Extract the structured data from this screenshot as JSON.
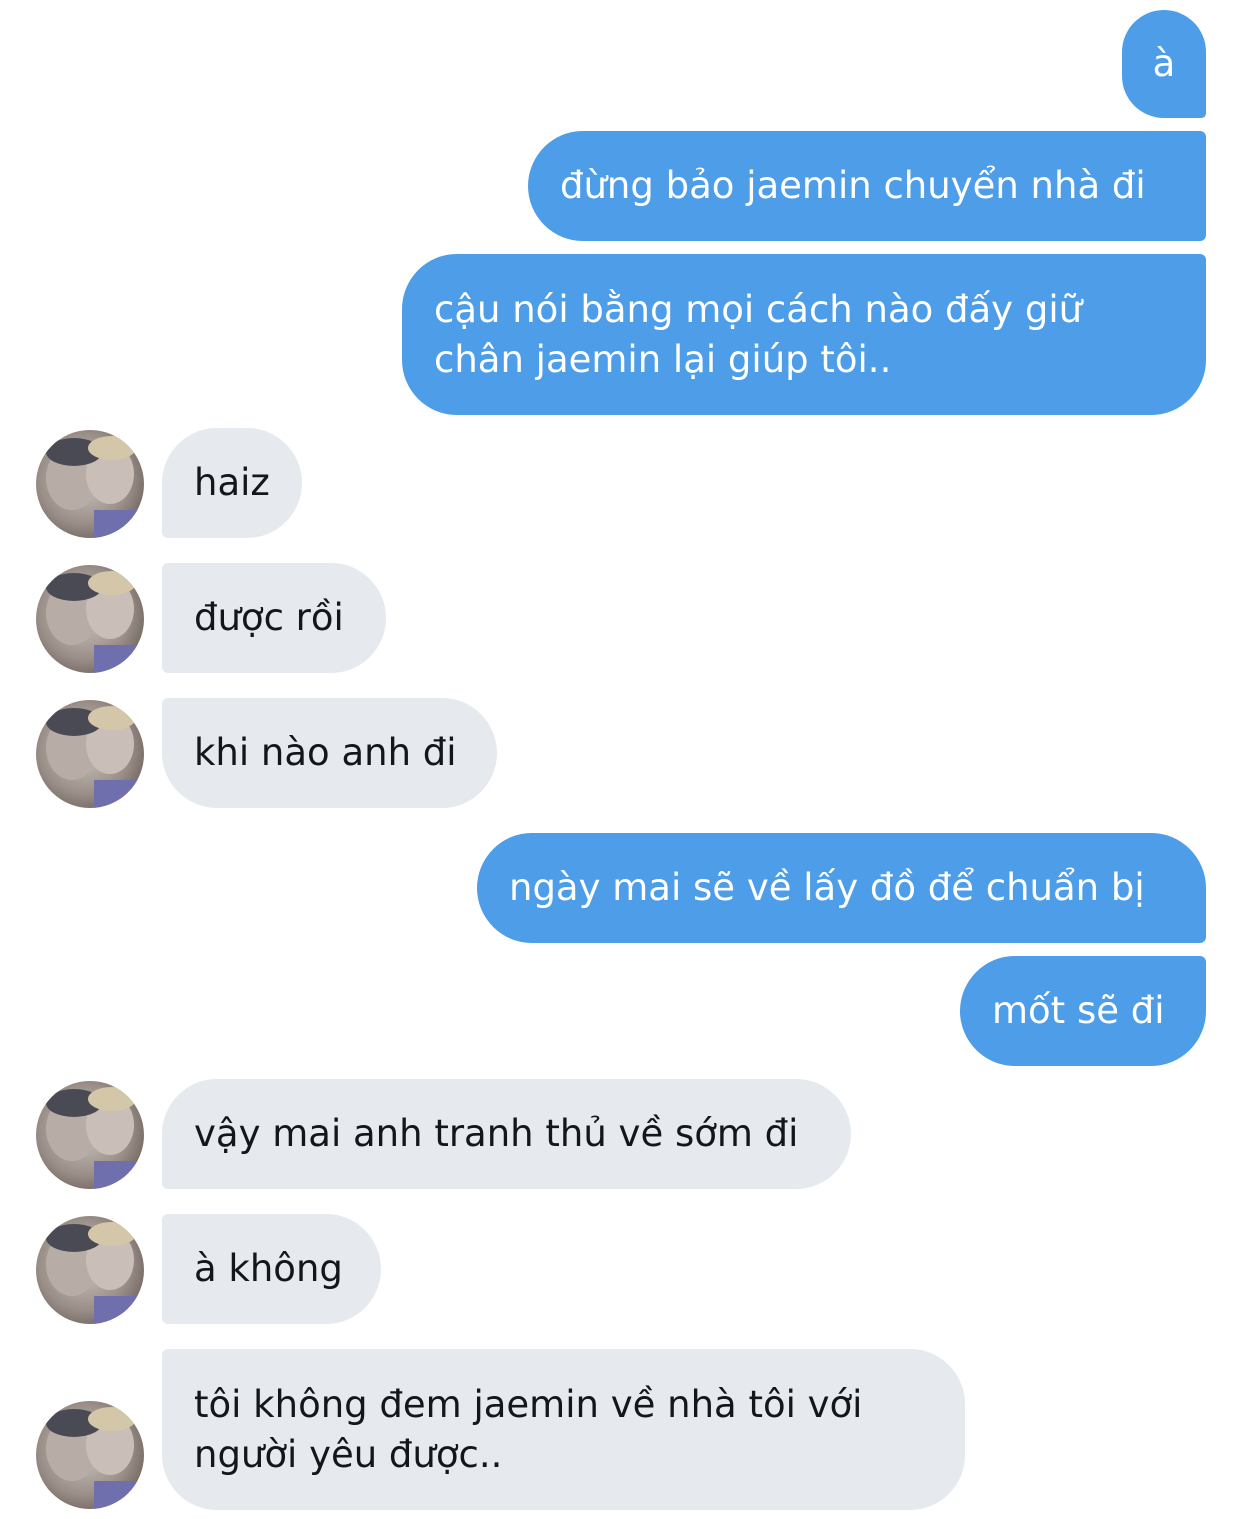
{
  "conversation": {
    "messages": [
      {
        "side": "out",
        "text": "à"
      },
      {
        "side": "out",
        "text": "đừng bảo jaemin chuyển nhà đi"
      },
      {
        "side": "out",
        "text": "cậu nói bằng mọi cách nào đấy giữ\nchân jaemin lại giúp tôi.."
      },
      {
        "side": "in",
        "text": "haiz"
      },
      {
        "side": "in",
        "text": "được rồi"
      },
      {
        "side": "in",
        "text": "khi nào anh đi"
      },
      {
        "side": "out",
        "text": "ngày mai sẽ về lấy đồ để chuẩn bị"
      },
      {
        "side": "out",
        "text": "mốt sẽ đi"
      },
      {
        "side": "in",
        "text": "vậy mai anh tranh thủ về sớm đi"
      },
      {
        "side": "in",
        "text": "à không"
      },
      {
        "side": "in",
        "text": "tôi không đem jaemin về nhà tôi với\nngười yêu được.."
      }
    ]
  },
  "colors": {
    "outgoing_bubble": "#4d9de8",
    "incoming_bubble": "#e6e9ee",
    "outgoing_text": "#ffffff",
    "incoming_text": "#14171a"
  },
  "avatar": {
    "icon": "profile-photo-icon"
  }
}
